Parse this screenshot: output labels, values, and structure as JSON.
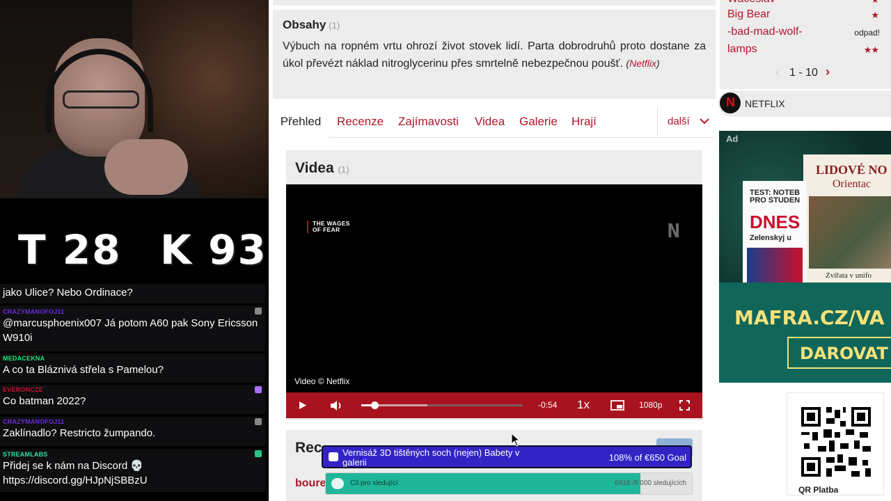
{
  "counter": {
    "t": "T 28",
    "k": "K 93"
  },
  "chat": [
    {
      "user": "",
      "user_color": "#9147ff",
      "text": "jako Ulice? Nebo Ordinace?"
    },
    {
      "user": "CRAZYMANOFOJ11",
      "user_color": "#6a2bd8",
      "text": "@marcusphoenix007 Já potom A60 pak Sony Ericsson W910i"
    },
    {
      "user": "MEDACEKNA",
      "user_color": "#1ee87a",
      "text": "A co ta Bláznivá střela s Pamelou?"
    },
    {
      "user": "EVERONCZE",
      "user_color": "#c8102e",
      "text": "Co batman 2022?"
    },
    {
      "user": "CRAZYMANOFOJ11",
      "user_color": "#6a2bd8",
      "text": "Zaklínadlo? Restricto žumpando."
    },
    {
      "user": "STREAMLABS",
      "user_color": "#33e0a0",
      "text": "Přidej se k nám na Discord 💀 https://discord.gg/HJpNjSBBzU"
    }
  ],
  "synopsis": {
    "title": "Obsahy",
    "count": "(1)",
    "text": "Výbuch na ropném vrtu ohrozí život stovek lidí. Parta dobrodruhů proto dostane za úkol převézt náklad nitroglycerinu přes smrtelně nebezpečnou poušť.",
    "source_open": "(",
    "source": "Netflix",
    "source_close": ")"
  },
  "tabs": [
    {
      "label": "Přehled",
      "active": true
    },
    {
      "label": "Recenze"
    },
    {
      "label": "Zajímavosti"
    },
    {
      "label": "Videa"
    },
    {
      "label": "Galerie"
    },
    {
      "label": "Hrají"
    }
  ],
  "tab_more": "další",
  "videos": {
    "title": "Videa",
    "count": "(1)",
    "overlay_title_line1": "THE WAGES",
    "overlay_title_line2": "OF FEAR",
    "watermark": "N",
    "credit": "Video © Netflix",
    "time_left": "-0:54",
    "speed": "1x",
    "quality": "1080p",
    "progress": 0.08,
    "buffered": 0.41
  },
  "reviews": {
    "title": "Rec",
    "first_user": "boure"
  },
  "goal": {
    "label": "Vernisáž 3D tištěných soch (nejen) Babety v galerii",
    "amount": "108% of €650 Goal",
    "progress": 1.0
  },
  "followers": {
    "label": "Cíl pro sledující",
    "count": "6918 /8 000 sledujících",
    "progress": 0.86
  },
  "ratings": [
    {
      "name": "Wačeslav",
      "stars": "★",
      "odpad": ""
    },
    {
      "name": "Big Bear",
      "stars": "★",
      "odpad": ""
    },
    {
      "name": "-bad-mad-wolf-",
      "stars": "",
      "odpad": "odpad!"
    },
    {
      "name": "lamps",
      "stars": "★★",
      "odpad": ""
    }
  ],
  "pager": {
    "text": "1 - 10",
    "prev": "‹",
    "next": "›"
  },
  "provider": {
    "name": "NETFLIX",
    "logo_letter": "N"
  },
  "ad": {
    "label": "Ad",
    "paper1_head": "TEST: NOTEB PRO STUDEN",
    "paper1_brand": "DNES",
    "paper1_sub": "Zelenskyj u",
    "paper2_head": "LIDOVÉ NO",
    "paper2_sub": "Orientac",
    "paper2_foot": "Zvířata v unifo",
    "url": "MAFRA.CZ/VA",
    "button": "DAROVAT"
  },
  "qr_label": "QR Platba",
  "colors": {
    "accent": "#b0162a",
    "goal": "#1a0a8e",
    "follow": "#1fb69a"
  }
}
